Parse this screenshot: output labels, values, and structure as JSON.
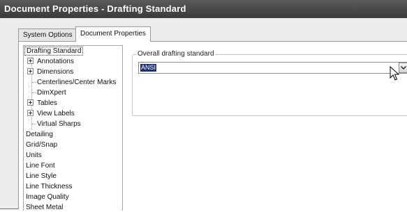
{
  "window": {
    "title": "Document Properties - Drafting Standard"
  },
  "tabs": [
    {
      "label": "System Options",
      "active": false
    },
    {
      "label": "Document Properties",
      "active": true
    }
  ],
  "tree": {
    "items": [
      {
        "label": "Drafting Standard",
        "selected": true
      },
      {
        "label": "Annotations",
        "expandable": true
      },
      {
        "label": "Dimensions",
        "expandable": true
      },
      {
        "label": "Centerlines/Center Marks"
      },
      {
        "label": "DimXpert"
      },
      {
        "label": "Tables",
        "expandable": true
      },
      {
        "label": "View Labels",
        "expandable": true
      },
      {
        "label": "Virtual Sharps"
      },
      {
        "label": "Detailing"
      },
      {
        "label": "Grid/Snap"
      },
      {
        "label": "Units"
      },
      {
        "label": "Line Font"
      },
      {
        "label": "Line Style"
      },
      {
        "label": "Line Thickness"
      },
      {
        "label": "Image Quality"
      },
      {
        "label": "Sheet Metal"
      }
    ]
  },
  "standard_group": {
    "label": "Overall drafting standard",
    "selected_value": "ANSI"
  },
  "icons": {
    "expand": "plus-box-icon",
    "dropdown": "chevron-down-icon",
    "cursor": "mouse-pointer-icon"
  },
  "colors": {
    "title_bar": "#4a4a4a",
    "selection_highlight": "#1f2f6b"
  }
}
